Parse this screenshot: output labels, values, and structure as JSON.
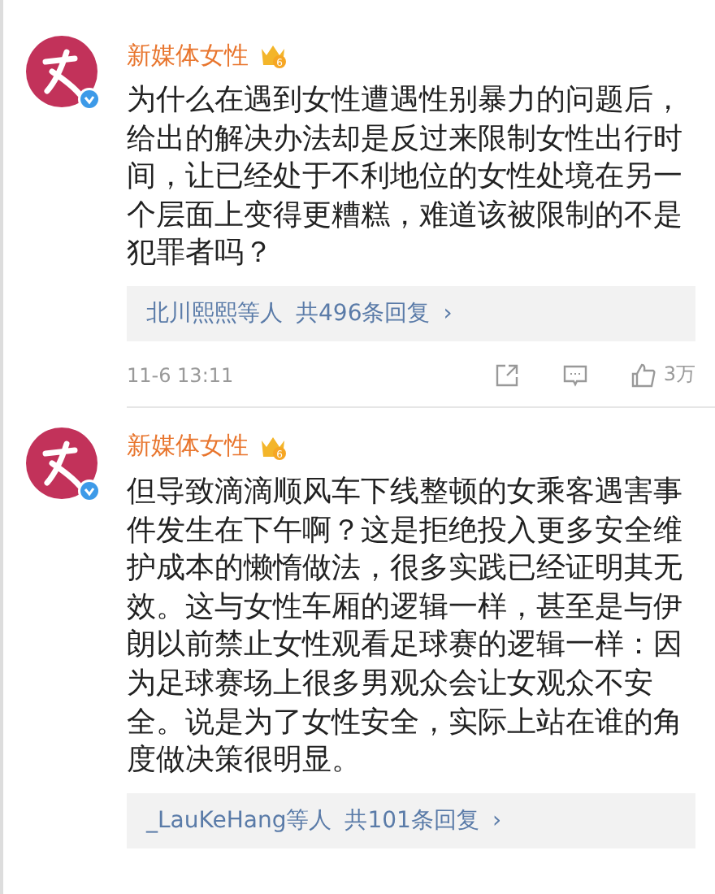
{
  "comments": [
    {
      "author": "新媒体女性",
      "badge": "6",
      "verified": true,
      "text": "为什么在遇到女性遭遇性别暴力的问题后，给出的解决办法却是反过来限制女性出行时间，让已经处于不利地位的女性处境在另一个层面上变得更糟糕，难道该被限制的不是犯罪者吗？",
      "replies": {
        "users": "北川熙熙",
        "suffix": "等人",
        "count": "共496条回复",
        "arrow": "›"
      },
      "time": "11-6 13:11",
      "likes": "3万"
    },
    {
      "author": "新媒体女性",
      "badge": "6",
      "verified": true,
      "text": "但导致滴滴顺风车下线整顿的女乘客遇害事件发生在下午啊？这是拒绝投入更多安全维护成本的懒惰做法，很多实践已经证明其无效。这与女性车厢的逻辑一样，甚至是与伊朗以前禁止女性观看足球赛的逻辑一样：因为足球赛场上很多男观众会让女观众不安全。说是为了女性安全，实际上站在谁的角度做决策很明显。",
      "replies": {
        "users": "_LauKeHang",
        "suffix": "等人",
        "count": "共101条回复",
        "arrow": "›"
      }
    }
  ]
}
